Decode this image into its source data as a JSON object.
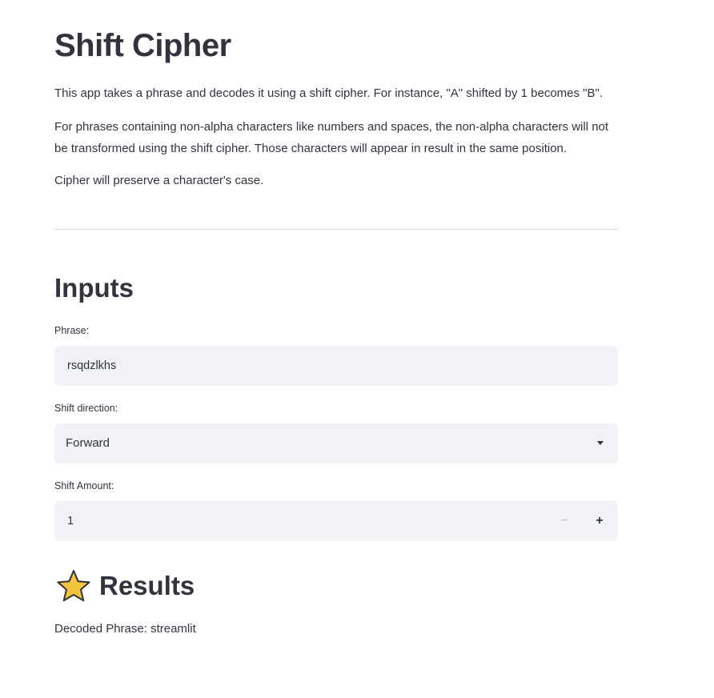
{
  "title": "Shift Cipher",
  "description": {
    "p1": "This app takes a phrase and decodes it using a shift cipher. For instance, \"A\" shifted by 1 becomes \"B\".",
    "p2": "For phrases containing non-alpha characters like numbers and spaces, the non-alpha characters will not be transformed using the shift cipher. Those characters will appear in result in the same position.",
    "p3": "Cipher will preserve a character's case."
  },
  "inputs": {
    "heading": "Inputs",
    "phrase": {
      "label": "Phrase:",
      "value": "rsqdzlkhs"
    },
    "direction": {
      "label": "Shift direction:",
      "value": "Forward",
      "icon": "chevron-down-icon"
    },
    "amount": {
      "label": "Shift Amount:",
      "value": "1",
      "minus": "−",
      "plus": "+"
    }
  },
  "results": {
    "heading": "Results",
    "icon": "star-icon",
    "decoded_label": "Decoded Phrase: streamlit"
  },
  "colors": {
    "text": "#31333f",
    "input_bg": "#f0f2f6",
    "divider": "#d5d6da",
    "star": "#f4c33c"
  }
}
